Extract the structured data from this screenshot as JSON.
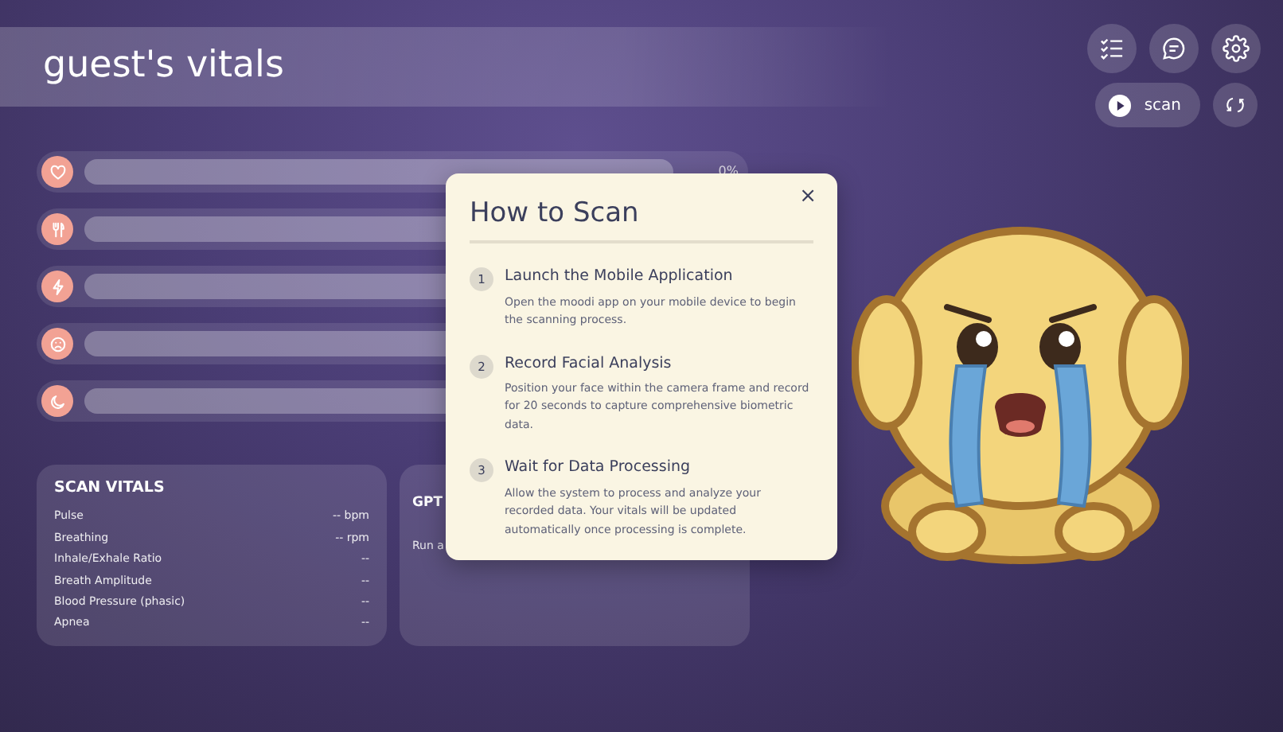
{
  "header": {
    "title": "guest's vitals"
  },
  "toolbar": {
    "scan_button": "scan"
  },
  "meters": [
    {
      "level": 0,
      "reading": "0%"
    },
    {
      "level": 0
    },
    {
      "level": 0
    },
    {
      "level": 0
    },
    {
      "level": 0
    }
  ],
  "scan_vitals": {
    "title": "SCAN VITALS",
    "rows": [
      {
        "label": "Pulse",
        "value": "-- bpm"
      },
      {
        "label": "Breathing",
        "value": "-- rpm"
      },
      {
        "label": "Inhale/Exhale Ratio",
        "value": "--"
      },
      {
        "label": "Breath Amplitude",
        "value": "--"
      },
      {
        "label": "Blood Pressure (phasic)",
        "value": "--"
      },
      {
        "label": "Apnea",
        "value": "--"
      }
    ]
  },
  "gpt_panel": {
    "title": "GPT",
    "text": "Run a"
  },
  "modal": {
    "title": "How to Scan",
    "close": "×",
    "steps": [
      {
        "number": "1",
        "title": "Launch the Mobile Application",
        "text": "Open the moodi app on your mobile device to begin the scanning process."
      },
      {
        "number": "2",
        "title": "Record Facial Analysis",
        "text": "Position your face within the camera frame and record for 20 seconds to capture comprehensive biometric data."
      },
      {
        "number": "3",
        "title": "Wait for Data Processing",
        "text": "Allow the system to process and analyze your recorded data. Your vitals will be updated automatically once processing is complete."
      }
    ]
  }
}
